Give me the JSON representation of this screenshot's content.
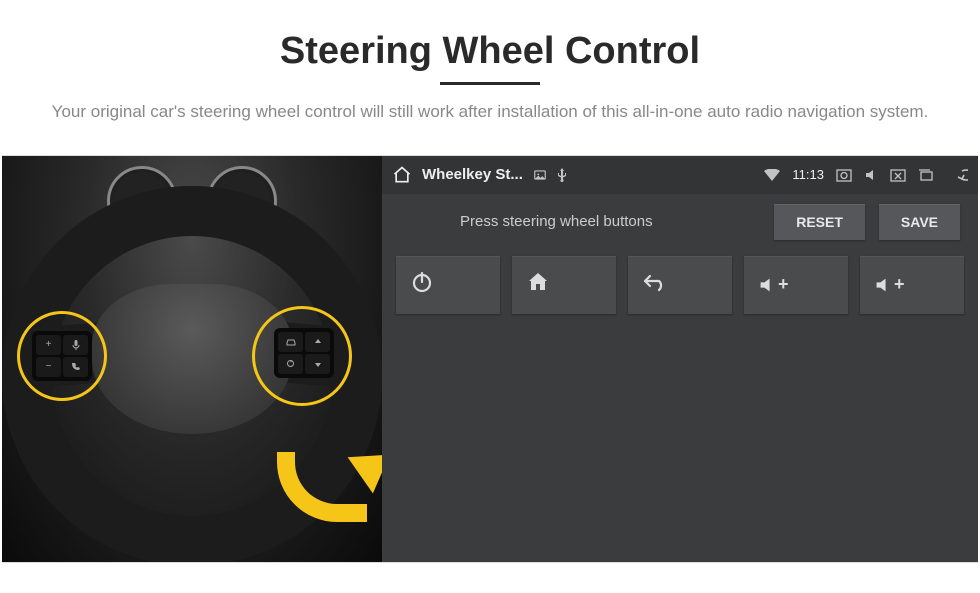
{
  "header": {
    "title": "Steering Wheel Control",
    "subtitle": "Your original car's steering wheel control will still work after installation of this all-in-one auto radio navigation system."
  },
  "wheel_buttons": {
    "left": [
      "+",
      "mic",
      "−",
      "phone"
    ],
    "right": [
      "car",
      "up",
      "cycle",
      "down"
    ]
  },
  "status_bar": {
    "app_title": "Wheelkey St...",
    "time": "11:13"
  },
  "toolbar": {
    "prompt": "Press steering wheel buttons",
    "reset_label": "RESET",
    "save_label": "SAVE"
  },
  "tiles": {
    "power": "power-icon",
    "home": "home-icon",
    "back": "back-icon",
    "vol_up_a": "vol-up",
    "vol_up_b": "vol-up",
    "vol_label_plus": "+"
  }
}
